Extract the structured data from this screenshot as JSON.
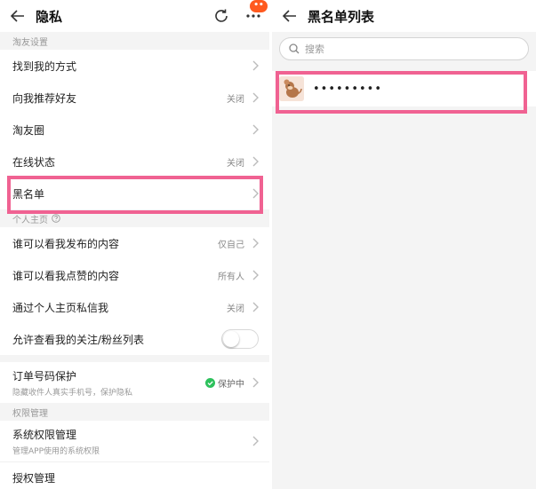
{
  "left": {
    "header": {
      "title": "隐私",
      "badge": "••"
    },
    "sections": [
      {
        "label": "淘友设置"
      },
      {
        "label": "个人主页"
      },
      {
        "label": "权限管理"
      }
    ],
    "rows": {
      "find_me": {
        "label": "找到我的方式",
        "value": ""
      },
      "recommend": {
        "label": "向我推荐好友",
        "value": "关闭"
      },
      "circle": {
        "label": "淘友圈",
        "value": ""
      },
      "online": {
        "label": "在线状态",
        "value": "关闭"
      },
      "blacklist": {
        "label": "黑名单",
        "value": ""
      },
      "who_posts": {
        "label": "谁可以看我发布的内容",
        "value": "仅自己"
      },
      "who_likes": {
        "label": "谁可以看我点赞的内容",
        "value": "所有人"
      },
      "dm": {
        "label": "通过个人主页私信我",
        "value": "关闭"
      },
      "follow_list": {
        "label": "允许查看我的关注/粉丝列表",
        "toggle_on": false
      },
      "order_protect": {
        "label": "订单号码保护",
        "sub": "隐藏收件人真实手机号，保护隐私",
        "status": "保护中"
      },
      "sys_perm": {
        "label": "系统权限管理",
        "sub": "管理APP使用的系统权限"
      },
      "auth": {
        "label": "授权管理"
      }
    },
    "colors": {
      "highlight": "#f06292",
      "badge": "#ff5a1f",
      "protect_green": "#2dc15c"
    }
  },
  "right": {
    "header": {
      "title": "黑名单列表"
    },
    "search": {
      "placeholder": "搜索",
      "value": ""
    },
    "items": [
      {
        "name": "•••••••••"
      }
    ]
  }
}
